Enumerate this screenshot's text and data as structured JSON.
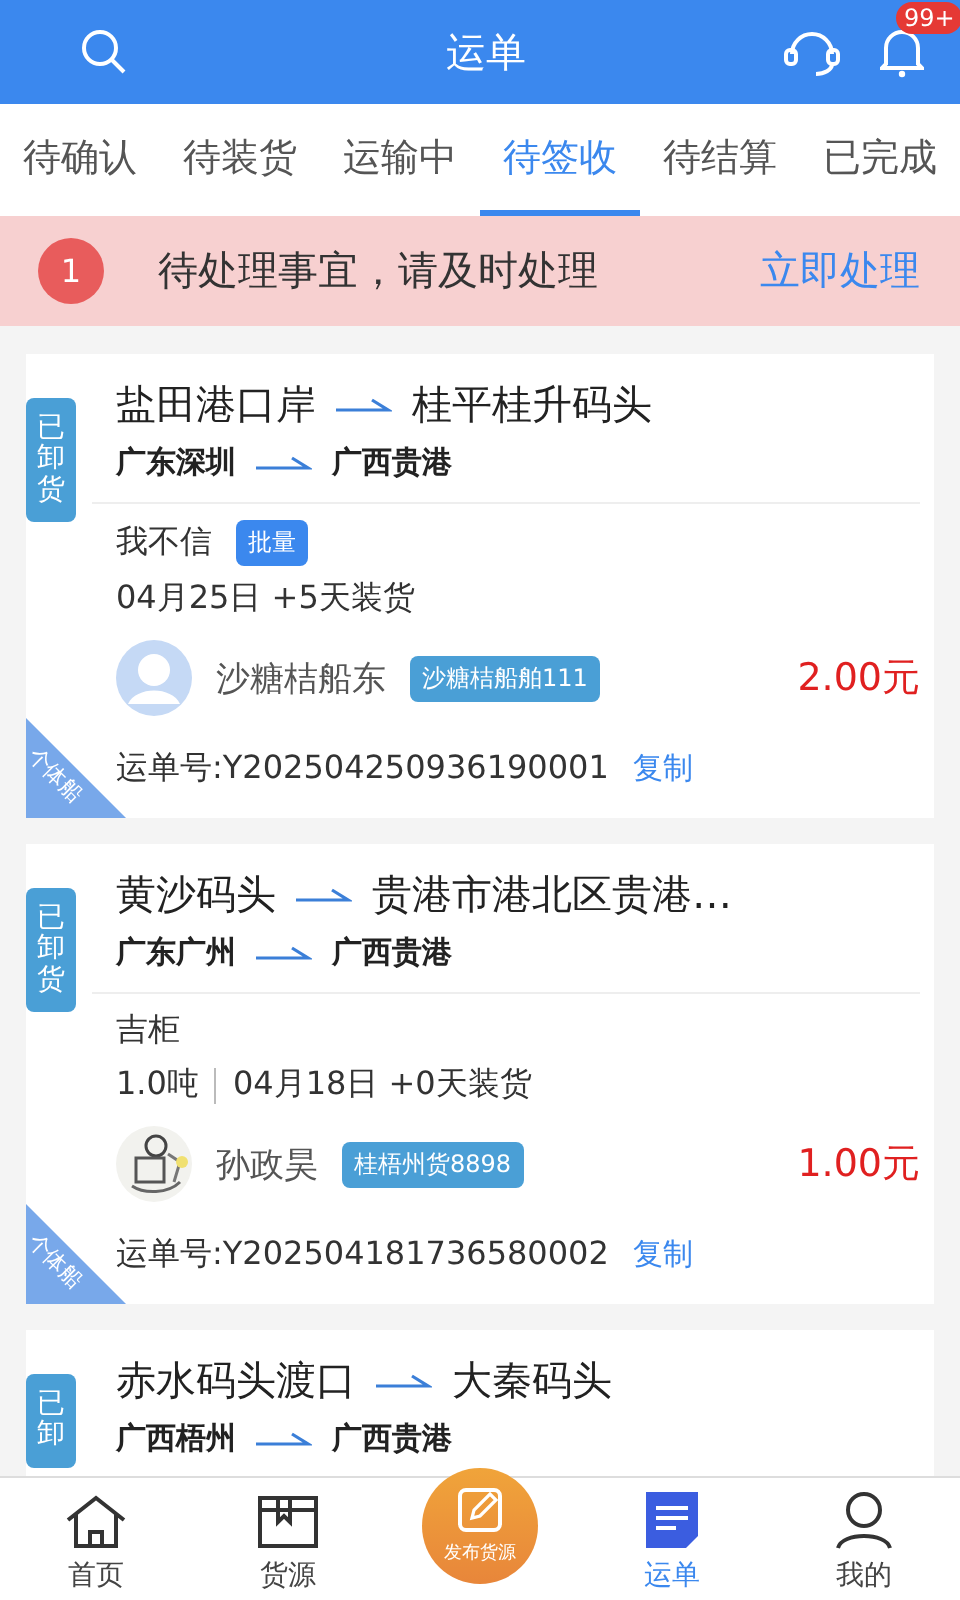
{
  "header": {
    "title": "运单",
    "badge": "99+"
  },
  "tabs": [
    {
      "label": "待确认",
      "selected": false
    },
    {
      "label": "待装货",
      "selected": false
    },
    {
      "label": "运输中",
      "selected": false
    },
    {
      "label": "待签收",
      "selected": true
    },
    {
      "label": "待结算",
      "selected": false
    },
    {
      "label": "已完成",
      "selected": false
    }
  ],
  "notice": {
    "count": "1",
    "text": "待处理事宜，请及时处理",
    "action": "立即处理"
  },
  "orders": [
    {
      "status": "已卸货",
      "corner": "个体船",
      "from": "盐田港口岸",
      "to": "桂平桂升码头",
      "from_region": "广东深圳",
      "to_region": "广西贵港",
      "cargo": "我不信",
      "cargo_tag": "批量",
      "load_date": "04月25日 +5天装货",
      "owner": "沙糖桔船东",
      "avatar": {
        "kind": "default"
      },
      "vessel": "沙糖桔船舶111",
      "price": "2.00元",
      "waybill": "运单号:Y202504250936190001",
      "copy": "复制"
    },
    {
      "status": "已卸货",
      "corner": "个体船",
      "from": "黄沙码头",
      "to": "贵港市港北区贵港…",
      "from_region": "广东广州",
      "to_region": "广西贵港",
      "cargo": "吉柜",
      "weight": "1.0吨",
      "load_date": "04月18日 +0天装货",
      "owner": "孙政昊",
      "vessel": "桂梧州货8898",
      "price": "1.00元",
      "waybill": "运单号:Y202504181736580002",
      "copy": "复制"
    },
    {
      "status": "已卸",
      "from": "赤水码头渡口",
      "to": "大秦码头",
      "from_region": "广西梧州",
      "to_region": "广西贵港"
    }
  ],
  "bottom_nav": [
    {
      "kind": "tab",
      "label": "首页",
      "selected": false
    },
    {
      "kind": "tab",
      "label": "货源",
      "selected": false
    },
    {
      "kind": "publish",
      "label": "发布货源",
      "selected": false
    },
    {
      "kind": "tab",
      "label": "运单",
      "selected": true
    },
    {
      "kind": "tab",
      "label": "我的",
      "selected": false
    }
  ]
}
